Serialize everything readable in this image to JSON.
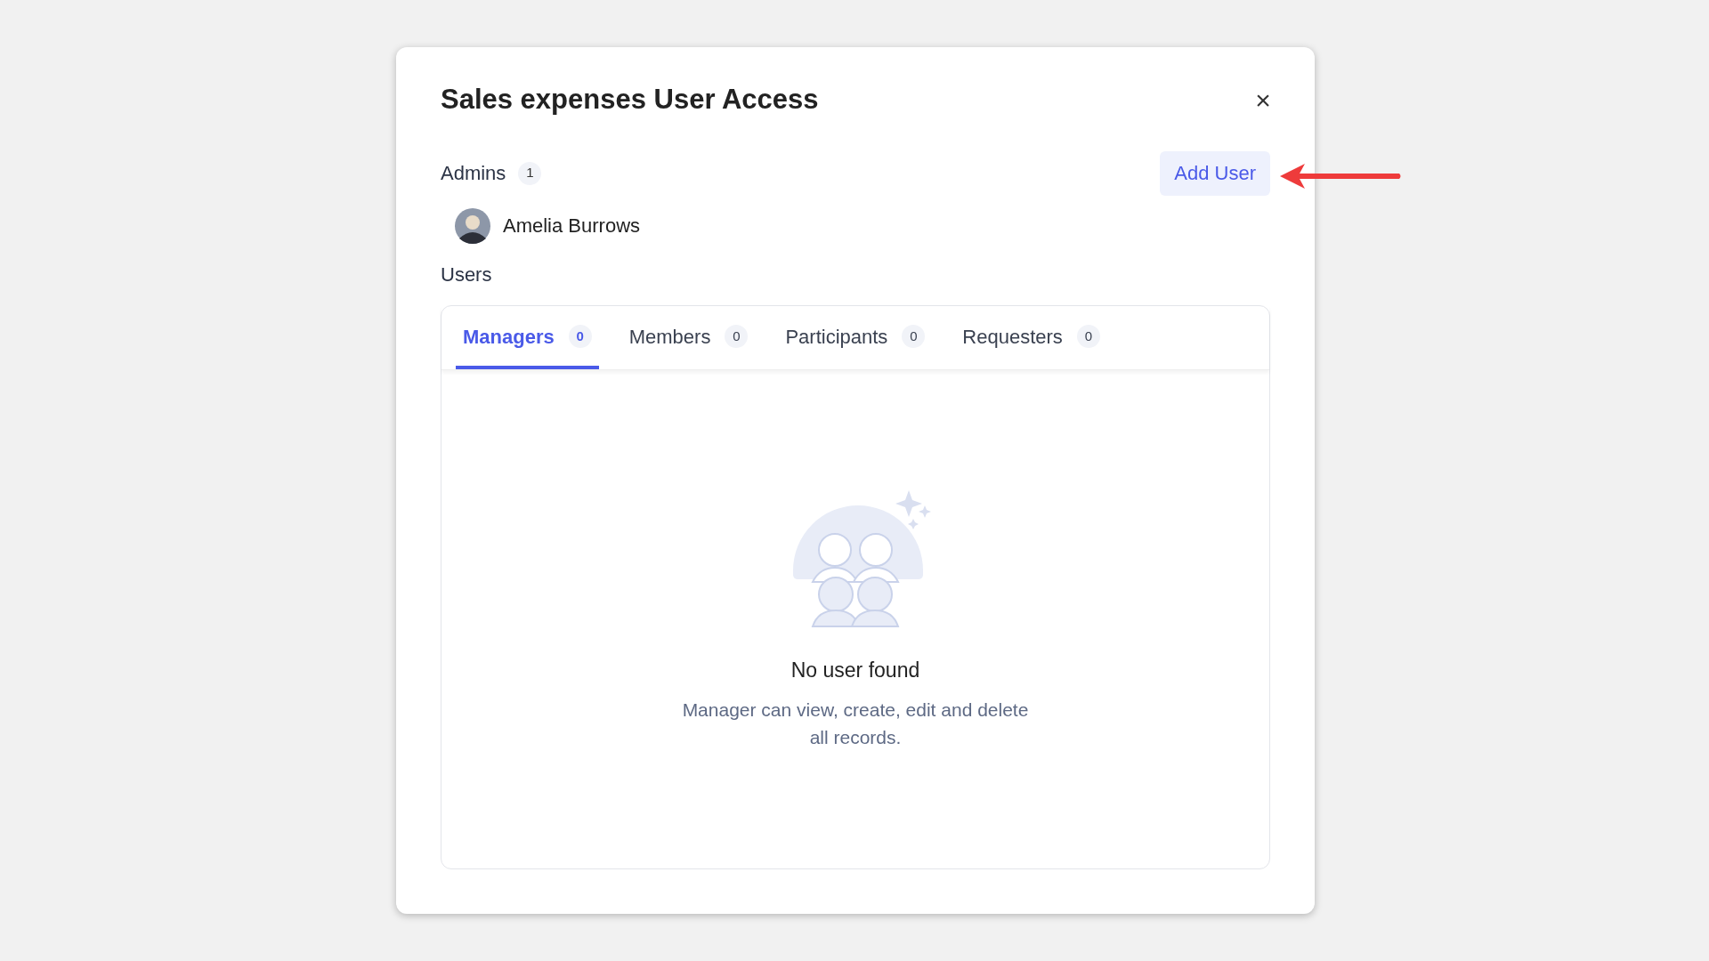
{
  "dialog": {
    "title": "Sales expenses User Access",
    "close_label": "×"
  },
  "admins": {
    "label": "Admins",
    "count": "1",
    "people": [
      {
        "name": "Amelia Burrows"
      }
    ]
  },
  "add_user": {
    "label": "Add User"
  },
  "users": {
    "label": "Users",
    "tabs": [
      {
        "label": "Managers",
        "count": "0",
        "selected": true
      },
      {
        "label": "Members",
        "count": "0",
        "selected": false
      },
      {
        "label": "Participants",
        "count": "0",
        "selected": false
      },
      {
        "label": "Requesters",
        "count": "0",
        "selected": false
      }
    ],
    "empty": {
      "title": "No user found",
      "description": "Manager can view, create, edit and delete all records."
    }
  }
}
